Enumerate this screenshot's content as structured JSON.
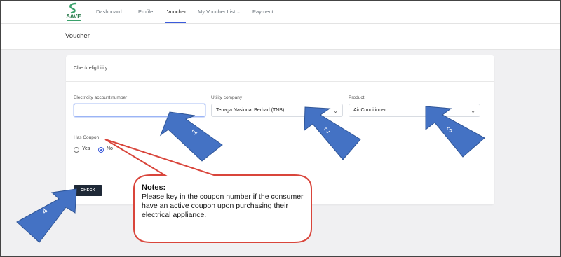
{
  "app": {
    "logo_text": "SAVE"
  },
  "nav": {
    "items": [
      {
        "label": "Dashboard"
      },
      {
        "label": "Profile"
      },
      {
        "label": "Voucher"
      },
      {
        "label": "My Voucher List"
      },
      {
        "label": "Payment"
      }
    ],
    "active": "Voucher"
  },
  "page": {
    "title": "Voucher"
  },
  "card": {
    "title": "Check eligibility"
  },
  "form": {
    "account": {
      "label": "Electricity account number",
      "value": ""
    },
    "utility": {
      "label": "Utility company",
      "value": "Tenaga Nasional Berhad (TNB)"
    },
    "product": {
      "label": "Product",
      "value": "Air Conditioner"
    },
    "coupon": {
      "label": "Has Coupon",
      "options": [
        {
          "label": "Yes",
          "selected": false
        },
        {
          "label": "No",
          "selected": true
        }
      ]
    },
    "check_label": "CHECK"
  },
  "annotations": {
    "note_title": "Notes:",
    "note_text": "Please key in the coupon number if the consumer have an active coupon upon purchasing their electrical appliance.",
    "arrows": [
      "1",
      "2",
      "3",
      "4"
    ]
  },
  "colors": {
    "accent": "#3b5bdb",
    "arrow_fill": "#4472c4",
    "callout_border": "#d9453b"
  }
}
